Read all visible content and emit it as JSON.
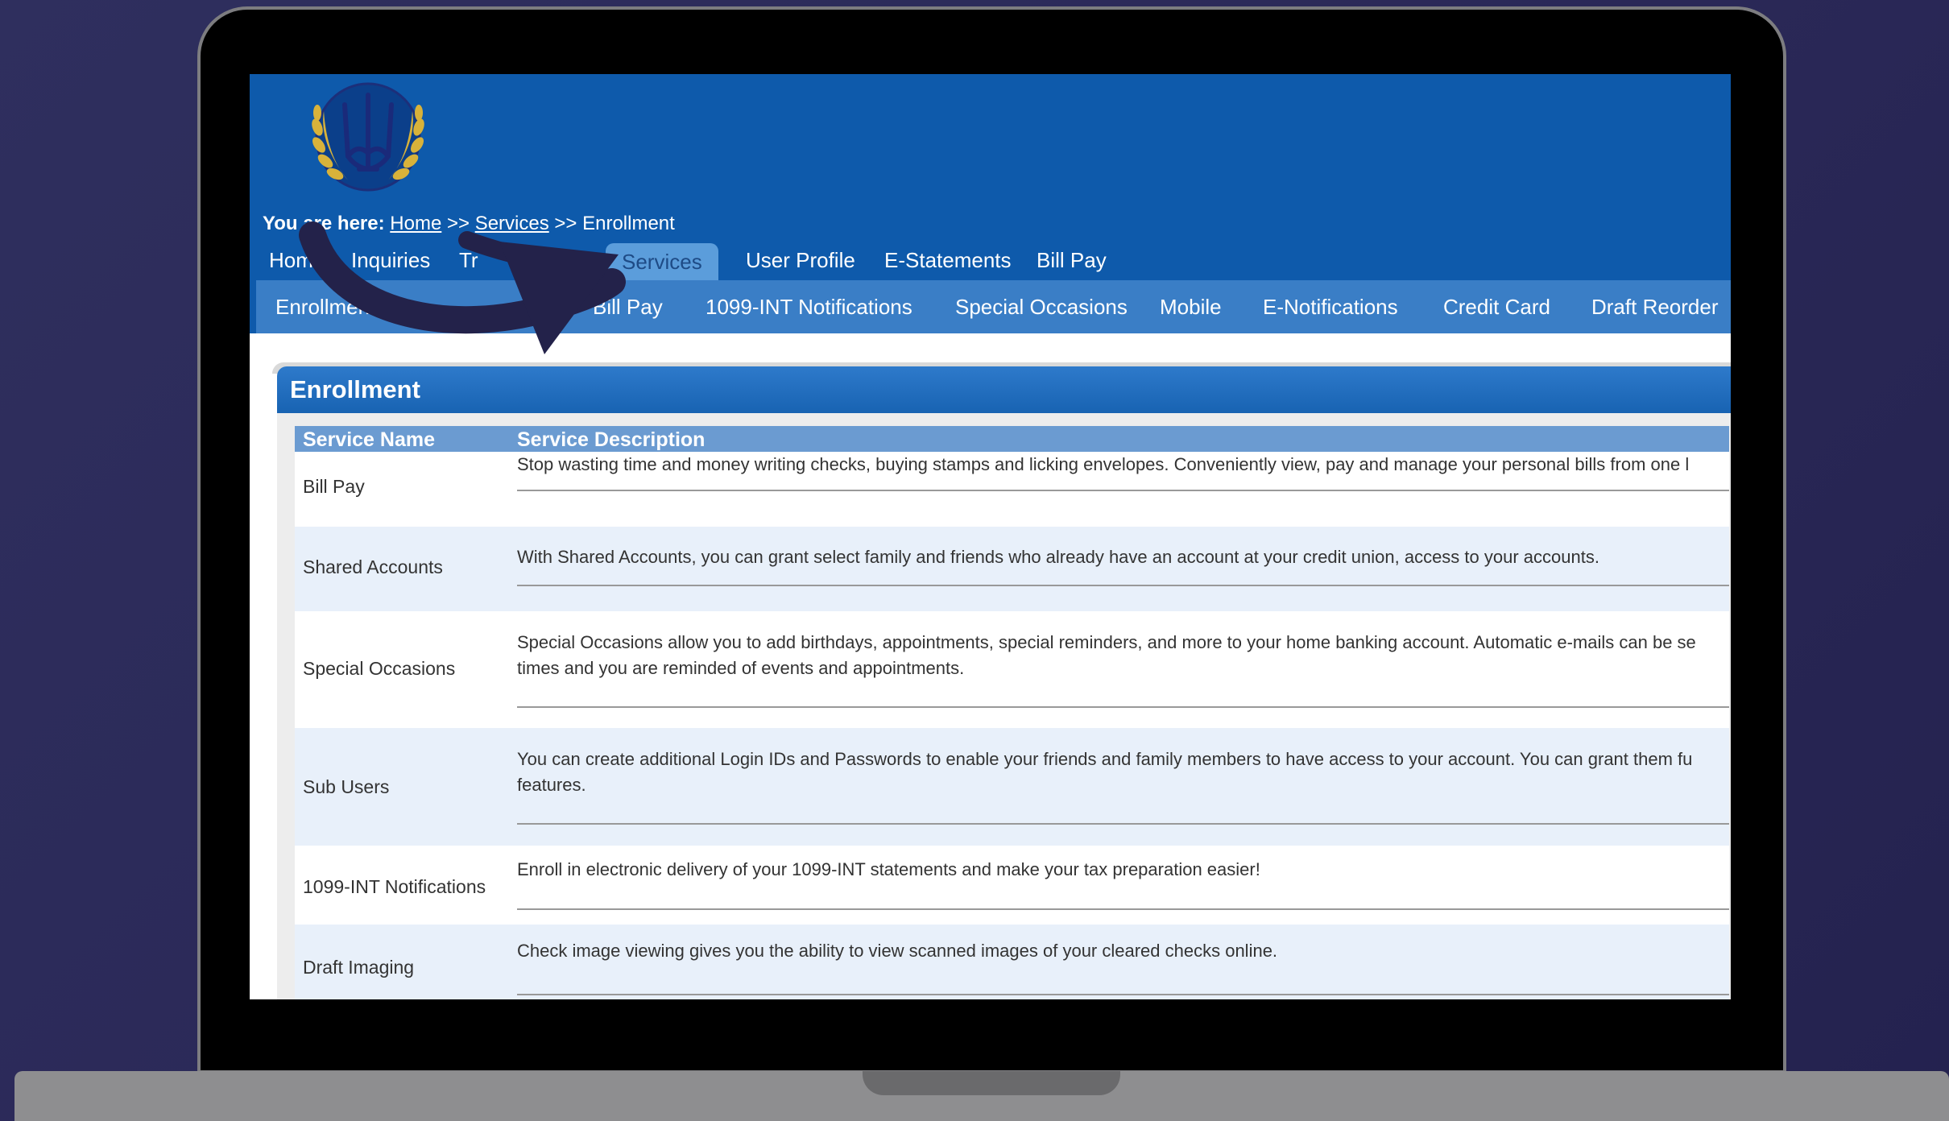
{
  "breadcrumb": {
    "prefix": "You are here:",
    "home": "Home",
    "sep1": ">>",
    "services": "Services",
    "sep2": ">>",
    "current": "Enrollment"
  },
  "main_nav": [
    {
      "label": "Home",
      "active": false
    },
    {
      "label": "Inquiries",
      "active": false
    },
    {
      "label": "Tr",
      "active": false
    },
    {
      "label": "Services",
      "active": true
    },
    {
      "label": "User Profile",
      "active": false
    },
    {
      "label": "E-Statements",
      "active": false
    },
    {
      "label": "Bill Pay",
      "active": false
    }
  ],
  "sub_nav": [
    {
      "label": "Enrollment"
    },
    {
      "label": "Bill Pay"
    },
    {
      "label": "1099-INT Notifications"
    },
    {
      "label": "Special Occasions"
    },
    {
      "label": "Mobile"
    },
    {
      "label": "E-Notifications"
    },
    {
      "label": "Credit Card"
    },
    {
      "label": "Draft Reorder"
    }
  ],
  "panel": {
    "title": "Enrollment"
  },
  "table": {
    "headers": [
      "Service Name",
      "Service Description"
    ],
    "rows": [
      {
        "name": "Bill Pay",
        "description": "Stop wasting time and money writing checks, buying stamps and licking envelopes. Conveniently view, pay and manage your personal bills from one l"
      },
      {
        "name": "Shared Accounts",
        "description": "With Shared Accounts, you can grant select family and friends who already have an account at your credit union, access to your accounts."
      },
      {
        "name": "Special Occasions",
        "description": "Special Occasions allow you to add birthdays, appointments, special reminders, and more to your home banking account. Automatic e-mails can be se",
        "description2": "times and you are reminded of events and appointments."
      },
      {
        "name": "Sub Users",
        "description": "You can create additional Login IDs and Passwords to enable your friends and family members to have access to your account. You can grant them fu",
        "description2": "features."
      },
      {
        "name": "1099-INT Notifications",
        "description": "Enroll in electronic delivery of your 1099-INT statements and make your tax preparation easier!"
      },
      {
        "name": "Draft Imaging",
        "description": "Check image viewing gives you the ability to view scanned images of your cleared checks online."
      }
    ]
  },
  "colors": {
    "banner": "#0e5aab",
    "sub_nav": "#3a7ec6",
    "active_tab": "#5b9ddb",
    "table_header": "#6b9bd1",
    "row_alt": "#e8f0fa",
    "arrow": "#23224a"
  },
  "icons": [
    "trident-crest-icon",
    "curved-arrow-icon"
  ]
}
